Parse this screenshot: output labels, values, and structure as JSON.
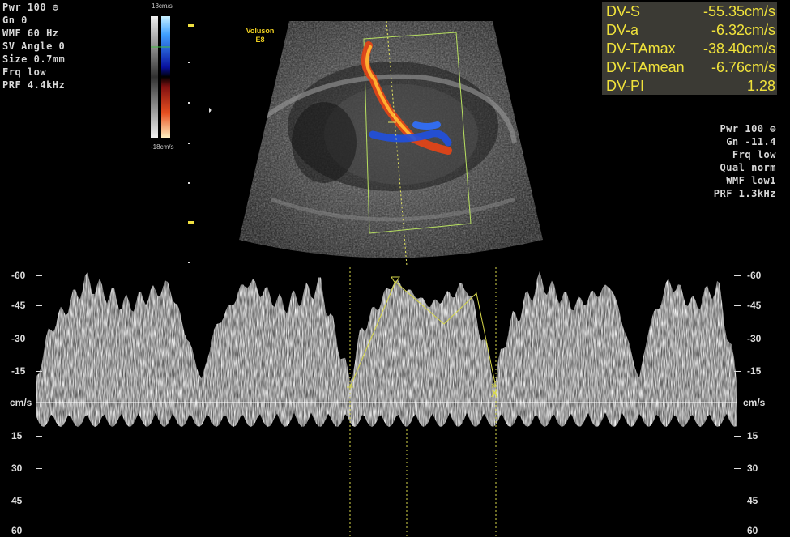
{
  "left_params": [
    "Pwr 100",
    "Gn  0",
    "WMF 60 Hz",
    "SV Angle  0",
    "Size  0.7mm",
    "Frq low",
    "PRF  4.4kHz"
  ],
  "right_params": [
    "Pwr 100",
    "Gn -11.4",
    "Frq low",
    "Qual norm",
    "WMF low1",
    "PRF  1.3kHz"
  ],
  "colorbar": {
    "top_label": "18cm/s",
    "bottom_label": "-18cm/s"
  },
  "brand": {
    "line1": "Voluson",
    "line2": "E8"
  },
  "measurements": [
    {
      "label": "DV-S",
      "value": "-55.35cm/s"
    },
    {
      "label": "DV-a",
      "value": "-6.32cm/s"
    },
    {
      "label": "DV-TAmax",
      "value": "-38.40cm/s"
    },
    {
      "label": "DV-TAmean",
      "value": "-6.76cm/s"
    },
    {
      "label": "DV-PI",
      "value": "1.28"
    }
  ],
  "spectrum": {
    "unit": "cm/s",
    "ticks_left": [
      "-60",
      "-45",
      "-30",
      "-15",
      "15",
      "30",
      "45",
      "60"
    ],
    "ticks_right": [
      "-60",
      "-45",
      "-30",
      "-15",
      "15",
      "30",
      "45",
      "60"
    ]
  },
  "colors": {
    "measure_text": "#f0e23b",
    "measure_bg": "#3b3a34",
    "caliper": "#d8d84a",
    "color_box": "#b8e060",
    "baseline": "#ffffff"
  },
  "icons": [
    "lock-icon",
    "cursor-marker-icon"
  ]
}
